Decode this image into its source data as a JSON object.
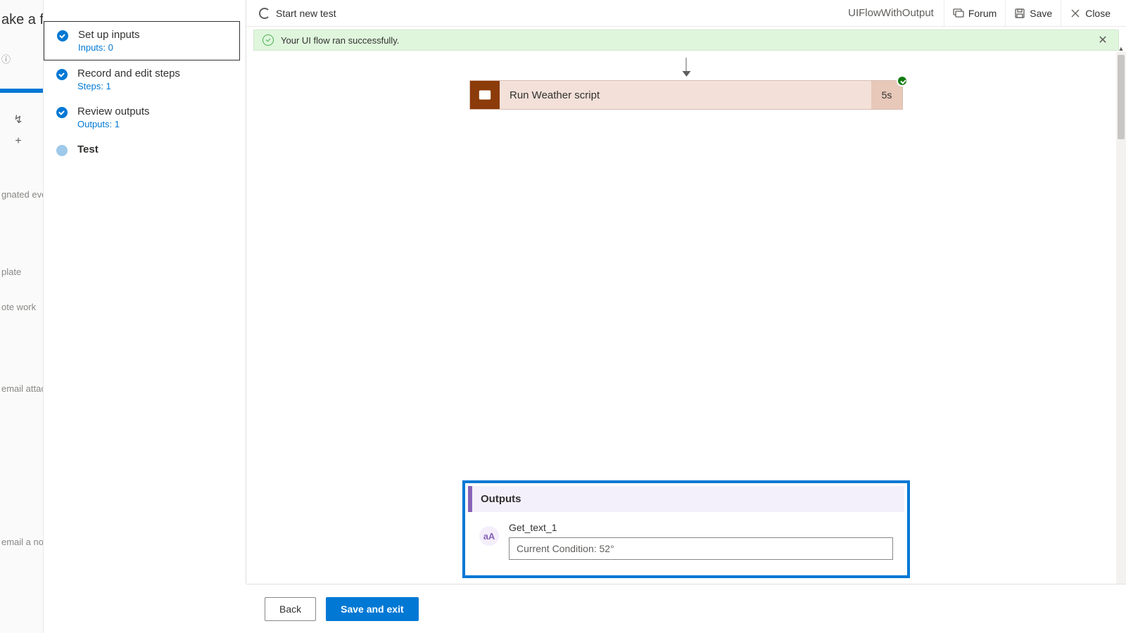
{
  "bg_panel": {
    "title_fragment": "ake a fl",
    "lines": [
      "gnated even",
      "plate",
      "ote work",
      "email attac",
      "email a no"
    ]
  },
  "steps": [
    {
      "title": "Set up inputs",
      "sub": "Inputs: 0",
      "state": "done",
      "selected": true
    },
    {
      "title": "Record and edit steps",
      "sub": "Steps: 1",
      "state": "done",
      "selected": false
    },
    {
      "title": "Review outputs",
      "sub": "Outputs: 1",
      "state": "done",
      "selected": false
    },
    {
      "title": "Test",
      "sub": "",
      "state": "active",
      "selected": false
    }
  ],
  "toolbar": {
    "start_new_test": "Start new test",
    "flow_name": "UIFlowWithOutput",
    "forum": "Forum",
    "save": "Save",
    "close": "Close"
  },
  "banner": {
    "message": "Your UI flow ran successfully."
  },
  "action": {
    "title": "Run Weather script",
    "duration": "5s"
  },
  "outputs": {
    "header": "Outputs",
    "var_icon": "aA",
    "var_name": "Get_text_1",
    "var_value": "Current Condition: 52°"
  },
  "footer": {
    "back": "Back",
    "save_and_exit": "Save and exit"
  }
}
